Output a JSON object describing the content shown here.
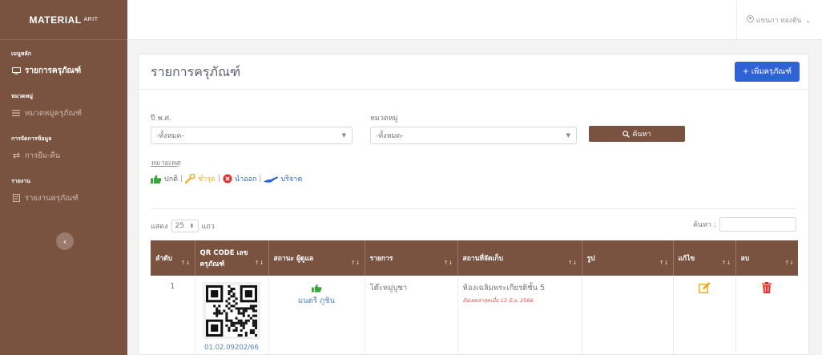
{
  "sidebar": {
    "brand": "MATERIAL",
    "brand_sup": "ARIT",
    "sections": [
      {
        "heading": "เมนูหลัก",
        "item": "รายการครุภัณฑ์",
        "active": true
      },
      {
        "heading": "หมวดหมู่",
        "item": "หมวดหมู่ครุภัณฑ์",
        "active": false
      },
      {
        "heading": "การจัดการข้อมูล",
        "item": "การยืม-คืน",
        "active": false
      },
      {
        "heading": "รายงาน",
        "item": "รายงานครุภัณฑ์",
        "active": false
      }
    ]
  },
  "topbar": {
    "user": "แขนภา ทองดัน"
  },
  "page": {
    "title": "รายการครุภัณฑ์",
    "add_label": "+ เพิ่มครุภัณฑ์"
  },
  "filters": {
    "year_label": "ปี พ.ศ.",
    "year_value": "-ทั้งหมด-",
    "cat_label": "หมวดหมู่",
    "cat_value": "-ทั้งหมด-",
    "search_label": "ค้นหา"
  },
  "legend": {
    "title": "หมายเหตุ",
    "normal": "ปกติ",
    "broken": "ชำรุด",
    "removed": "นำออก",
    "donated": "บริจาค"
  },
  "table_controls": {
    "show_prefix": "แสดง",
    "page_size": "25",
    "show_suffix": "แถว",
    "search_label": "ค้นหา :"
  },
  "table": {
    "headers": [
      "ลำดับ",
      "QR CODE เลขครุภัณฑ์",
      "สถานะ ผู้ดูแล",
      "รายการ",
      "สถานที่จัดเก็บ",
      "รูป",
      "แก้ไข",
      "ลบ"
    ],
    "rows": [
      {
        "no": "1",
        "code": "01.02.09202/66",
        "keeper": "มนตรี ภูชิน",
        "item": "โต๊ะหมู่บูชา",
        "location": "ห้องเฉลิมพระเกียรติชั้น 5",
        "updated": "อัปเดตล่าสุดเมื่อ 13 มิ.ย. 2566"
      }
    ]
  },
  "colors": {
    "sidebar": "#7a5340",
    "primary": "#2f62d6",
    "danger": "#e0302b",
    "edit": "#f0ad1e",
    "ok": "#3aa53a"
  }
}
